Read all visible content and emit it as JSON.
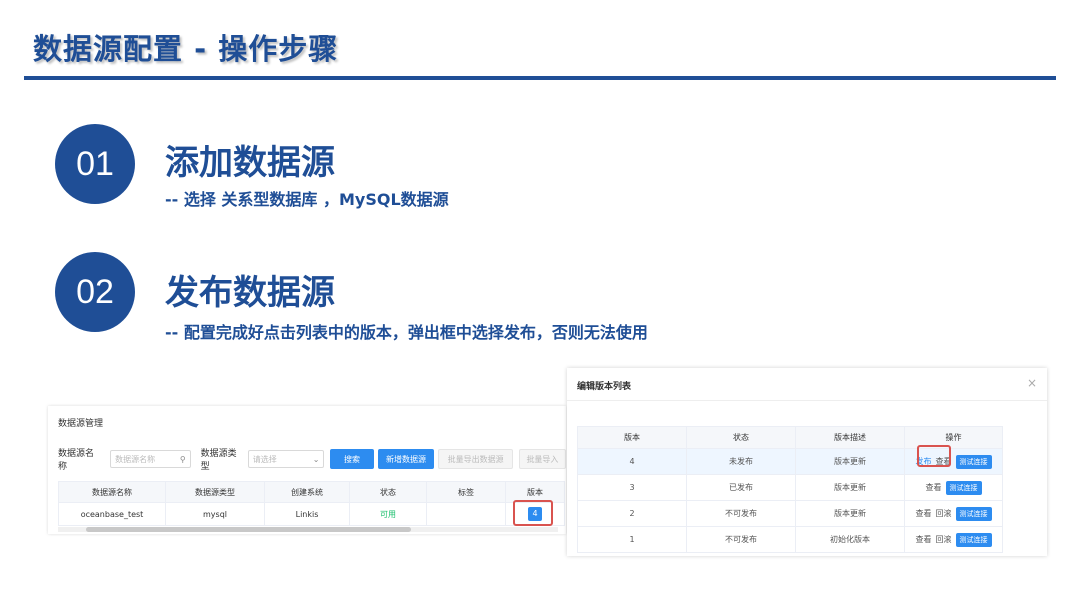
{
  "slide": {
    "title": "数据源配置 - 操作步骤",
    "steps": [
      {
        "number": "01",
        "title": "添加数据源",
        "desc": "-- 选择 关系型数据库 ，MySQL数据源"
      },
      {
        "number": "02",
        "title": "发布数据源",
        "desc": "-- 配置完成好点击列表中的版本，弹出框中选择发布，否则无法使用"
      }
    ]
  },
  "left_panel": {
    "header": "数据源管理",
    "name_label": "数据源名称",
    "name_placeholder": "数据源名称",
    "type_label": "数据源类型",
    "type_placeholder": "请选择",
    "search_button": "搜索",
    "add_button": "新增数据源",
    "export_button": "批量导出数据源",
    "import_button": "批量导入",
    "columns": [
      "数据源名称",
      "数据源类型",
      "创建系统",
      "状态",
      "标签",
      "版本"
    ],
    "rows": [
      {
        "name": "oceanbase_test",
        "type": "mysql",
        "system": "Linkis",
        "status": "可用",
        "tags": "",
        "version": "4"
      }
    ]
  },
  "right_panel": {
    "title": "编辑版本列表",
    "close": "×",
    "columns": [
      "版本",
      "状态",
      "版本描述",
      "操作"
    ],
    "rows": [
      {
        "version": "4",
        "status": "未发布",
        "desc": "版本更新",
        "actions": [
          "发布",
          "查看"
        ],
        "test": "测试连接"
      },
      {
        "version": "3",
        "status": "已发布",
        "desc": "版本更新",
        "actions": [
          "查看"
        ],
        "test": "测试连接"
      },
      {
        "version": "2",
        "status": "不可发布",
        "desc": "版本更新",
        "actions": [
          "查看",
          "回滚"
        ],
        "test": "测试连接"
      },
      {
        "version": "1",
        "status": "不可发布",
        "desc": "初始化版本",
        "actions": [
          "查看",
          "回滚"
        ],
        "test": "测试连接"
      }
    ]
  },
  "colors": {
    "brand": "#1f4e96",
    "primary": "#2d8cf0",
    "highlight": "#d9534f",
    "success": "#19be6b"
  }
}
